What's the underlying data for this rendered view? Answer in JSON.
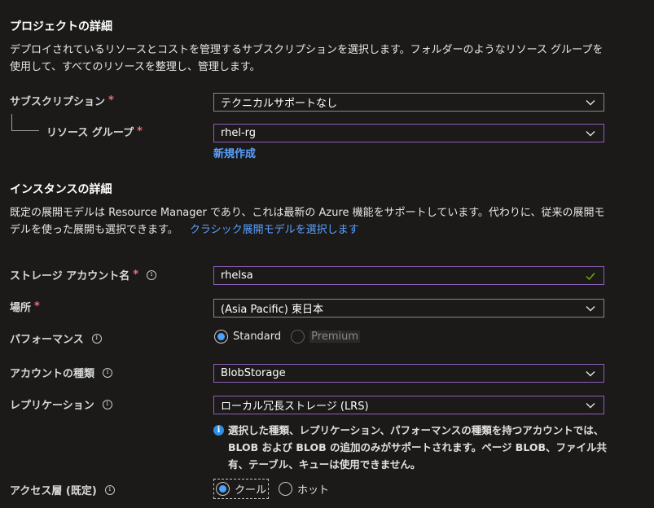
{
  "project": {
    "heading": "プロジェクトの詳細",
    "description": "デプロイされているリソースとコストを管理するサブスクリプションを選択します。フォルダーのようなリソース グループを使用して、すべてのリソースを整理し、管理します。",
    "subscription_label": "サブスクリプション",
    "subscription_value": "テクニカルサポートなし",
    "resource_group_label": "リソース グループ",
    "resource_group_value": "rhel-rg",
    "create_new_link": "新規作成",
    "required_mark": "*"
  },
  "instance": {
    "heading": "インスタンスの詳細",
    "description": "既定の展開モデルは Resource Manager であり、これは最新の Azure 機能をサポートしています。代わりに、従来の展開モデルを使った展開も選択できます。",
    "classic_link": "クラシック展開モデルを選択します",
    "storage_name_label": "ストレージ アカウント名",
    "storage_name_value": "rhelsa",
    "location_label": "場所",
    "location_value": "(Asia Pacific) 東日本",
    "performance_label": "パフォーマンス",
    "performance_options": [
      "Standard",
      "Premium"
    ],
    "performance_selected": "Standard",
    "account_kind_label": "アカウントの種類",
    "account_kind_value": "BlobStorage",
    "replication_label": "レプリケーション",
    "replication_value": "ローカル冗長ストレージ (LRS)",
    "replication_note": "選択した種類、レプリケーション、パフォーマンスの種類を持つアカウントでは、BLOB および BLOB の追加のみがサポートされます。ページ BLOB、ファイル共有、テーブル、キューは使用できません。",
    "access_tier_label": "アクセス層 (既定)",
    "access_tier_options": [
      "クール",
      "ホット"
    ],
    "access_tier_selected": "クール"
  },
  "icons": {
    "info": "info-icon",
    "chevron": "chevron-down-icon",
    "check": "check-icon"
  },
  "colors": {
    "background": "#1b1a19",
    "link": "#5aa0ff",
    "required": "#f1707b",
    "focus_border": "#8e5fb8",
    "valid_check": "#6bb700",
    "radio_selected": "#4aa3ff"
  }
}
